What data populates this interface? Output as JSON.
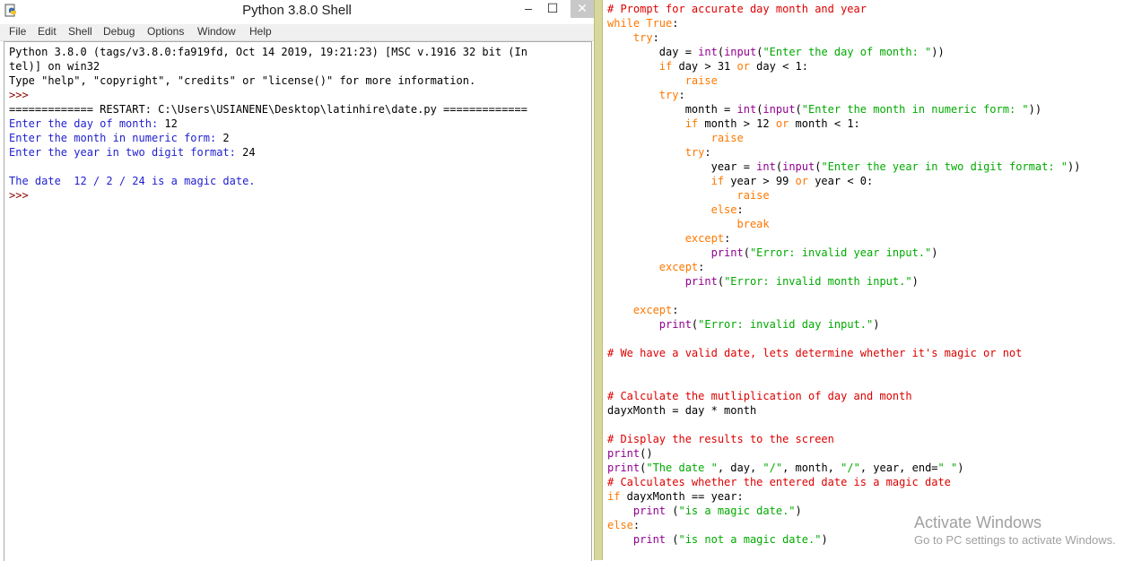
{
  "window": {
    "title": "Python 3.8.0 Shell",
    "min": "–",
    "max": "☐",
    "close": "✕"
  },
  "menu": [
    "File",
    "Edit",
    "Shell",
    "Debug",
    "Options",
    "Window",
    "Help"
  ],
  "shell_lines": [
    {
      "text": "Python 3.8.0 (tags/v3.8.0:fa919fd, Oct 14 2019, 19:21:23) [MSC v.1916 32 bit (In",
      "kind": "out"
    },
    {
      "text": "tel)] on win32",
      "kind": "out"
    },
    {
      "text": "Type \"help\", \"copyright\", \"credits\" or \"license()\" for more information.",
      "kind": "out"
    },
    {
      "text": ">>> ",
      "kind": "prompt"
    },
    {
      "text": "============= RESTART: C:\\Users\\USIANENE\\Desktop\\latinhire\\date.py =============",
      "kind": "restart"
    },
    {
      "text": "Enter the day of month: 12",
      "kind": "io"
    },
    {
      "text": "Enter the month in numeric form: 2",
      "kind": "io"
    },
    {
      "text": "Enter the year in two digit format: 24",
      "kind": "io"
    },
    {
      "text": "",
      "kind": "out"
    },
    {
      "text": "The date  12 / 2 / 24 is a magic date.",
      "kind": "stdout"
    },
    {
      "text": ">>> ",
      "kind": "prompt"
    }
  ],
  "editor_lines": [
    [
      [
        "com",
        "# Prompt for accurate day month and year"
      ]
    ],
    [
      [
        "kw",
        "while"
      ],
      [
        "nm",
        " "
      ],
      [
        "kw",
        "True"
      ],
      [
        "nm",
        ":"
      ]
    ],
    [
      [
        "nm",
        "    "
      ],
      [
        "kw",
        "try"
      ],
      [
        "nm",
        ":"
      ]
    ],
    [
      [
        "nm",
        "        day = "
      ],
      [
        "bi",
        "int"
      ],
      [
        "nm",
        "("
      ],
      [
        "bi",
        "input"
      ],
      [
        "nm",
        "("
      ],
      [
        "str",
        "\"Enter the day of month: \""
      ],
      [
        "nm",
        "))"
      ]
    ],
    [
      [
        "nm",
        "        "
      ],
      [
        "kw",
        "if"
      ],
      [
        "nm",
        " day > 31 "
      ],
      [
        "kw",
        "or"
      ],
      [
        "nm",
        " day < 1:"
      ]
    ],
    [
      [
        "nm",
        "            "
      ],
      [
        "kw",
        "raise"
      ]
    ],
    [
      [
        "nm",
        "        "
      ],
      [
        "kw",
        "try"
      ],
      [
        "nm",
        ":"
      ]
    ],
    [
      [
        "nm",
        "            month = "
      ],
      [
        "bi",
        "int"
      ],
      [
        "nm",
        "("
      ],
      [
        "bi",
        "input"
      ],
      [
        "nm",
        "("
      ],
      [
        "str",
        "\"Enter the month in numeric form: \""
      ],
      [
        "nm",
        "))"
      ]
    ],
    [
      [
        "nm",
        "            "
      ],
      [
        "kw",
        "if"
      ],
      [
        "nm",
        " month > 12 "
      ],
      [
        "kw",
        "or"
      ],
      [
        "nm",
        " month < 1:"
      ]
    ],
    [
      [
        "nm",
        "                "
      ],
      [
        "kw",
        "raise"
      ]
    ],
    [
      [
        "nm",
        "            "
      ],
      [
        "kw",
        "try"
      ],
      [
        "nm",
        ":"
      ]
    ],
    [
      [
        "nm",
        "                year = "
      ],
      [
        "bi",
        "int"
      ],
      [
        "nm",
        "("
      ],
      [
        "bi",
        "input"
      ],
      [
        "nm",
        "("
      ],
      [
        "str",
        "\"Enter the year in two digit format: \""
      ],
      [
        "nm",
        "))"
      ]
    ],
    [
      [
        "nm",
        "                "
      ],
      [
        "kw",
        "if"
      ],
      [
        "nm",
        " year > 99 "
      ],
      [
        "kw",
        "or"
      ],
      [
        "nm",
        " year < 0:"
      ]
    ],
    [
      [
        "nm",
        "                    "
      ],
      [
        "kw",
        "raise"
      ]
    ],
    [
      [
        "nm",
        "                "
      ],
      [
        "kw",
        "else"
      ],
      [
        "nm",
        ":"
      ]
    ],
    [
      [
        "nm",
        "                    "
      ],
      [
        "kw",
        "break"
      ]
    ],
    [
      [
        "nm",
        "            "
      ],
      [
        "kw",
        "except"
      ],
      [
        "nm",
        ":"
      ]
    ],
    [
      [
        "nm",
        "                "
      ],
      [
        "bi",
        "print"
      ],
      [
        "nm",
        "("
      ],
      [
        "str",
        "\"Error: invalid year input.\""
      ],
      [
        "nm",
        ")"
      ]
    ],
    [
      [
        "nm",
        "        "
      ],
      [
        "kw",
        "except"
      ],
      [
        "nm",
        ":"
      ]
    ],
    [
      [
        "nm",
        "            "
      ],
      [
        "bi",
        "print"
      ],
      [
        "nm",
        "("
      ],
      [
        "str",
        "\"Error: invalid month input.\""
      ],
      [
        "nm",
        ")"
      ]
    ],
    [
      [
        "nm",
        ""
      ]
    ],
    [
      [
        "nm",
        "    "
      ],
      [
        "kw",
        "except"
      ],
      [
        "nm",
        ":"
      ]
    ],
    [
      [
        "nm",
        "        "
      ],
      [
        "bi",
        "print"
      ],
      [
        "nm",
        "("
      ],
      [
        "str",
        "\"Error: invalid day input.\""
      ],
      [
        "nm",
        ")"
      ]
    ],
    [
      [
        "nm",
        ""
      ]
    ],
    [
      [
        "com",
        "# We have a valid date, lets determine whether it's magic or not"
      ]
    ],
    [
      [
        "nm",
        ""
      ]
    ],
    [
      [
        "nm",
        ""
      ]
    ],
    [
      [
        "com",
        "# Calculate the mutliplication of day and month"
      ]
    ],
    [
      [
        "nm",
        "dayxMonth = day * month"
      ]
    ],
    [
      [
        "nm",
        ""
      ]
    ],
    [
      [
        "com",
        "# Display the results to the screen"
      ]
    ],
    [
      [
        "bi",
        "print"
      ],
      [
        "nm",
        "()"
      ]
    ],
    [
      [
        "bi",
        "print"
      ],
      [
        "nm",
        "("
      ],
      [
        "str",
        "\"The date \""
      ],
      [
        "nm",
        ", day, "
      ],
      [
        "str",
        "\"/\""
      ],
      [
        "nm",
        ", month, "
      ],
      [
        "str",
        "\"/\""
      ],
      [
        "nm",
        ", year, end="
      ],
      [
        "str",
        "\" \""
      ],
      [
        "nm",
        ")"
      ]
    ],
    [
      [
        "com",
        "# Calculates whether the entered date is a magic date"
      ]
    ],
    [
      [
        "kw",
        "if"
      ],
      [
        "nm",
        " dayxMonth == year:"
      ]
    ],
    [
      [
        "nm",
        "    "
      ],
      [
        "bi",
        "print"
      ],
      [
        "nm",
        " ("
      ],
      [
        "str",
        "\"is a magic date.\""
      ],
      [
        "nm",
        ")"
      ]
    ],
    [
      [
        "kw",
        "else"
      ],
      [
        "nm",
        ":"
      ]
    ],
    [
      [
        "nm",
        "    "
      ],
      [
        "bi",
        "print"
      ],
      [
        "nm",
        " ("
      ],
      [
        "str",
        "\"is not a magic date.\""
      ],
      [
        "nm",
        ")"
      ]
    ]
  ],
  "watermark": {
    "title": "Activate Windows",
    "subtitle": "Go to PC settings to activate Windows."
  }
}
